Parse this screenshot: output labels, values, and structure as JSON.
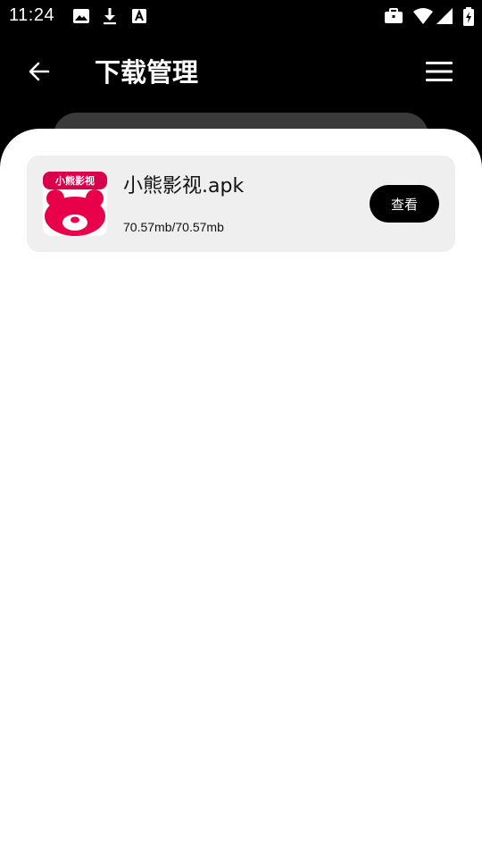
{
  "status_bar": {
    "time": "11:24",
    "icons": [
      "image-icon",
      "download-icon",
      "font-icon",
      "briefcase-icon",
      "wifi-icon",
      "cellular-signal-icon",
      "battery-charging-icon"
    ],
    "text_color": "#ffffff"
  },
  "header": {
    "title": "下载管理",
    "back_icon": "arrow-left-icon",
    "menu_icon": "hamburger-menu-icon",
    "background": "#000000"
  },
  "downloads": [
    {
      "app_icon": "bear-app-icon",
      "icon_text": "小熊影视",
      "icon_color": "#e8004a",
      "file_name": "小熊影视.apk",
      "size_text": "70.57mb/70.57mb",
      "action_label": "查看"
    }
  ],
  "colors": {
    "card_bg": "#efefef",
    "sheet_bg": "#ffffff",
    "button_bg": "#000000",
    "accent": "#e8004a"
  }
}
